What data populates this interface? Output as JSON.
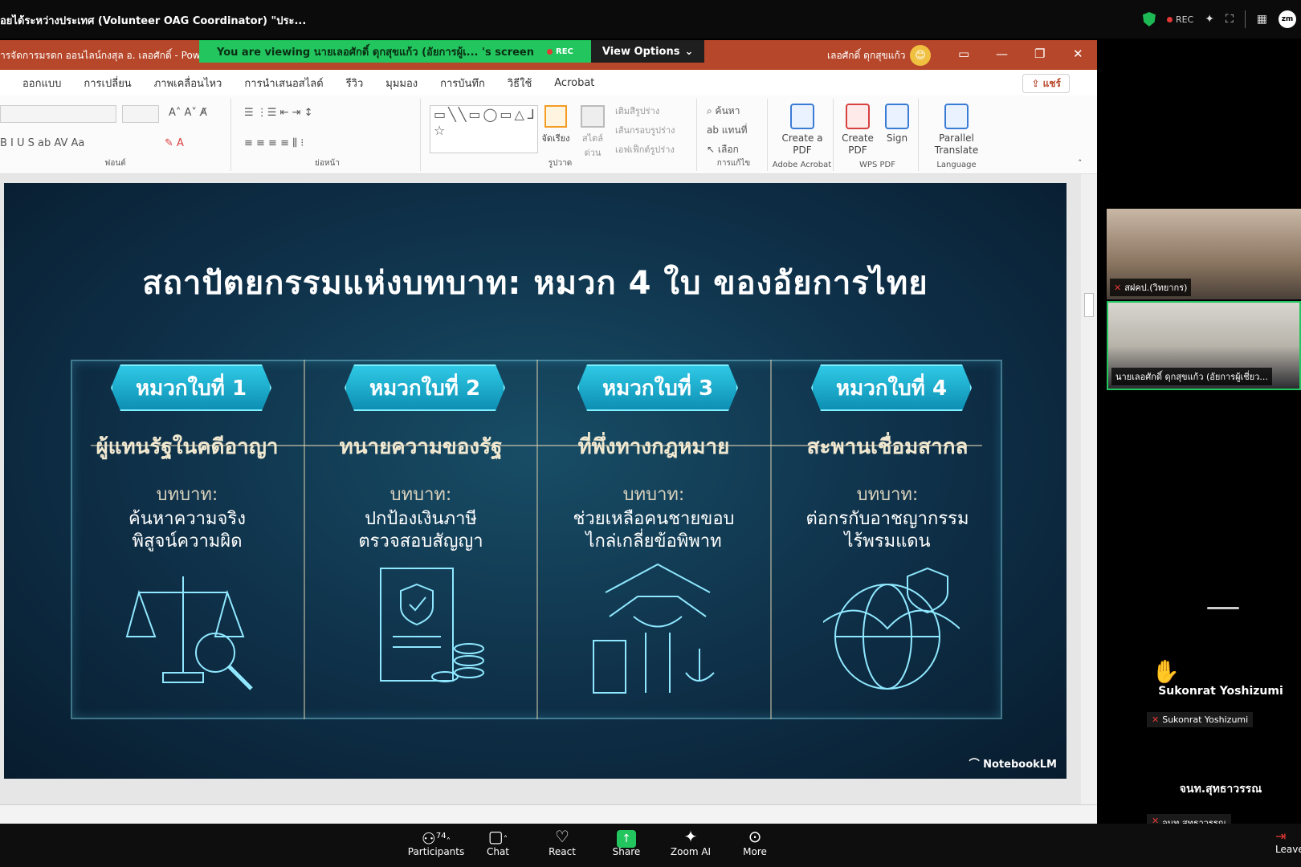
{
  "zoom": {
    "meeting_title": "อยได้ระหว่างประเทศ (Volunteer OAG Coordinator) \"ประ...",
    "rec_label": "REC",
    "zm_badge": "zm"
  },
  "ppt": {
    "doc_title": "ารจัดการมรดก ออนไลน์กงสุล อ. เลอศักดิ์ - Power",
    "viewing_message": "You are viewing  นายเลอศักดิ์ ดุกสุขแก้ว (อัยการผู้เ...  's screen",
    "viewing_rec": "REC",
    "view_options": "View Options",
    "user_name": "เลอศักดิ์ ดุกสุขแก้ว",
    "tabs": [
      "ออกแบบ",
      "การเปลี่ยน",
      "ภาพเคลื่อนไหว",
      "การนำเสนอสไลด์",
      "รีวิว",
      "มุมมอง",
      "การบันทึก",
      "วิธีใช้",
      "Acrobat"
    ],
    "share_button": "แชร์",
    "ribbon": {
      "font_group": "ฟอนต์",
      "paragraph_group": "ย่อหน้า",
      "drawing_group": "รูปวาด",
      "editing_group": "การแก้ไข",
      "arrange": "จัดเรียง",
      "quick_styles": "สไตล์ด่วน",
      "shape_fill": "เติมสีรูปร่าง",
      "shape_outline": "เส้นกรอบรูปร่าง",
      "shape_effects": "เอฟเฟ็กต์รูปร่าง",
      "find": "ค้นหา",
      "replace": "แทนที่",
      "select": "เลือก",
      "create_pdf_adobe": "Create a PDF",
      "adobe_group": "Adobe Acrobat",
      "create_pdf_wps": "Create PDF",
      "sign": "Sign",
      "wps_group": "WPS PDF",
      "parallel_translate": "Parallel Translate",
      "language_group": "Language"
    }
  },
  "slide": {
    "title": "สถาปัตยกรรมแห่งบทบาท: หมวก 4 ใบ ของอัยการไทย",
    "logo": "NotebookLM",
    "hats": [
      {
        "badge": "หมวกใบที่ 1",
        "subtitle": "ผู้แทนรัฐในคดีอาญา",
        "role_label": "บทบาท:",
        "line1": "ค้นหาความจริง",
        "line2": "พิสูจน์ความผิด",
        "icon": "scales-magnifier-icon"
      },
      {
        "badge": "หมวกใบที่ 2",
        "subtitle": "ทนายความของรัฐ",
        "role_label": "บทบาท:",
        "line1": "ปกป้องเงินภาษี",
        "line2": "ตรวจสอบสัญญา",
        "icon": "contract-shield-coins-icon"
      },
      {
        "badge": "หมวกใบที่ 3",
        "subtitle": "ที่พึ่งทางกฎหมาย",
        "role_label": "บทบาท:",
        "line1": "ช่วยเหลือคนชายขอบ",
        "line2": "ไกล่เกลี่ยข้อพิพาท",
        "icon": "handshake-door-icon"
      },
      {
        "badge": "หมวกใบที่ 4",
        "subtitle": "สะพานเชื่อมสากล",
        "role_label": "บทบาท:",
        "line1": "ต่อกรกับอาชญากรรม",
        "line2": "ไร้พรมแดน",
        "icon": "globe-bridge-shield-icon"
      }
    ]
  },
  "gallery": {
    "tile1_label": "สฝคป.(วิทยากร)",
    "tile2_label": "นายเลอศักดิ์ ดุกสุขแก้ว (อัยการผู้เชี่ยว...",
    "p1_name": "Sukonrat Yoshizumi",
    "p1_label": "Sukonrat Yoshizumi",
    "p2_name": "จนท.สุทธาวรรณ",
    "p2_label": "จนท.สุทธาวรรณ"
  },
  "toolbar": {
    "participants_count": "74",
    "participants": "Participants",
    "chat": "Chat",
    "react": "React",
    "share": "Share",
    "zoom_ai": "Zoom AI",
    "more": "More",
    "leave": "Leave"
  }
}
